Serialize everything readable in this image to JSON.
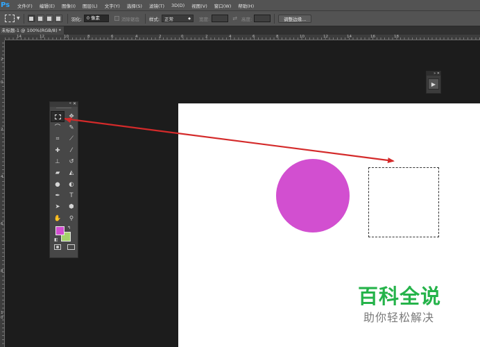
{
  "app": {
    "logo": "Ps"
  },
  "menu": [
    "文件(F)",
    "编辑(E)",
    "图像(I)",
    "图层(L)",
    "文字(Y)",
    "选择(S)",
    "滤镜(T)",
    "3D(D)",
    "视图(V)",
    "窗口(W)",
    "帮助(H)"
  ],
  "options": {
    "feather_label": "羽化:",
    "feather_value": "0 像素",
    "antialias_label": "消除锯齿",
    "style_label": "样式:",
    "style_value": "正常",
    "width_label": "宽度:",
    "height_label": "高度:",
    "refine_edge": "调整边缘..."
  },
  "document": {
    "tab_title": "未标题-1 @ 100%(RGB/8) *"
  },
  "rulers": {
    "horizontal": [
      "14",
      "12",
      "10",
      "8",
      "6",
      "4",
      "2",
      "0",
      "2",
      "4",
      "6",
      "8",
      "10",
      "12",
      "14",
      "16",
      "18"
    ],
    "vertical": [
      "2",
      "0",
      "2",
      "4",
      "6",
      "8",
      "1",
      "0"
    ]
  },
  "colors": {
    "foreground": "#d24fd0",
    "background": "#a5d26b",
    "circle": "#d24fd0",
    "arrow": "#d42a2a",
    "watermark_green": "#25b34a"
  },
  "toolbox": {
    "tools": [
      [
        "rectangular-marquee-icon",
        "move-icon"
      ],
      [
        "lasso-icon",
        "quick-selection-icon"
      ],
      [
        "crop-icon",
        "eyedropper-icon"
      ],
      [
        "spot-healing-icon",
        "brush-icon"
      ],
      [
        "clone-stamp-icon",
        "history-brush-icon"
      ],
      [
        "eraser-icon",
        "paint-bucket-icon"
      ],
      [
        "blur-icon",
        "dodge-icon"
      ],
      [
        "pen-icon",
        "type-icon"
      ],
      [
        "path-selection-icon",
        "shape-icon"
      ],
      [
        "hand-icon",
        "zoom-icon"
      ]
    ],
    "type_tool_glyph": "T"
  },
  "watermark": {
    "title": "百科全说",
    "subtitle": "助你轻松解决"
  }
}
